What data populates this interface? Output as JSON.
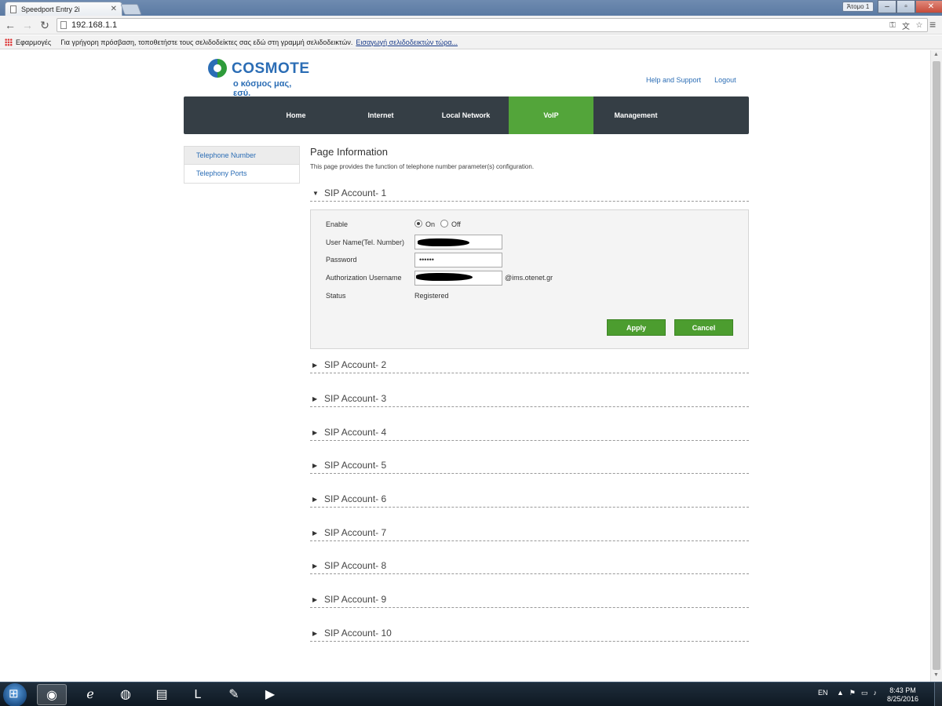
{
  "browser": {
    "tab_title": "Speedport Entry 2i",
    "tab_close": "✕",
    "user_label": "Άτομο 1",
    "url": "192.168.1.1",
    "bookmarks": {
      "apps_label": "Εφαρμογές",
      "hint": "Για γρήγορη πρόσβαση, τοποθετήστε τους σελιδοδείκτες σας εδώ στη γραμμή σελιδοδεικτών.",
      "import_link": "Εισαγωγή σελιδοδεικτών τώρα..."
    }
  },
  "brand": {
    "name": "COSMOTE",
    "tagline": "ο κόσμος μας, εσύ.",
    "colors": {
      "blue": "#2b6db5",
      "green": "#53a53a",
      "nav_bg": "#353e45"
    }
  },
  "header_links": {
    "help": "Help and Support",
    "logout": "Logout"
  },
  "nav": {
    "items": [
      {
        "label": "Home"
      },
      {
        "label": "Internet"
      },
      {
        "label": "Local Network"
      },
      {
        "label": "VoIP"
      },
      {
        "label": "Management"
      }
    ],
    "active": "VoIP"
  },
  "sidebar": {
    "items": [
      {
        "label": "Telephone Number"
      },
      {
        "label": "Telephony Ports"
      }
    ],
    "active": "Telephone Number"
  },
  "content": {
    "title": "Page Information",
    "description": "This page provides the function of telephone number parameter(s) configuration.",
    "accounts": [
      {
        "label": "SIP Account- 1",
        "expanded": true
      },
      {
        "label": "SIP Account- 2",
        "expanded": false
      },
      {
        "label": "SIP Account- 3",
        "expanded": false
      },
      {
        "label": "SIP Account- 4",
        "expanded": false
      },
      {
        "label": "SIP Account- 5",
        "expanded": false
      },
      {
        "label": "SIP Account- 6",
        "expanded": false
      },
      {
        "label": "SIP Account- 7",
        "expanded": false
      },
      {
        "label": "SIP Account- 8",
        "expanded": false
      },
      {
        "label": "SIP Account- 9",
        "expanded": false
      },
      {
        "label": "SIP Account- 10",
        "expanded": false
      }
    ],
    "form": {
      "enable_label": "Enable",
      "on_label": "On",
      "off_label": "Off",
      "enable_value": "On",
      "username_label": "User Name(Tel. Number)",
      "password_label": "Password",
      "password_value": "••••••",
      "auth_username_label": "Authorization Username",
      "auth_suffix": "@ims.otenet.gr",
      "status_label": "Status",
      "status_value": "Registered",
      "apply_label": "Apply",
      "cancel_label": "Cancel"
    }
  },
  "taskbar": {
    "language": "EN",
    "time": "8:43 PM",
    "date": "8/25/2016"
  }
}
